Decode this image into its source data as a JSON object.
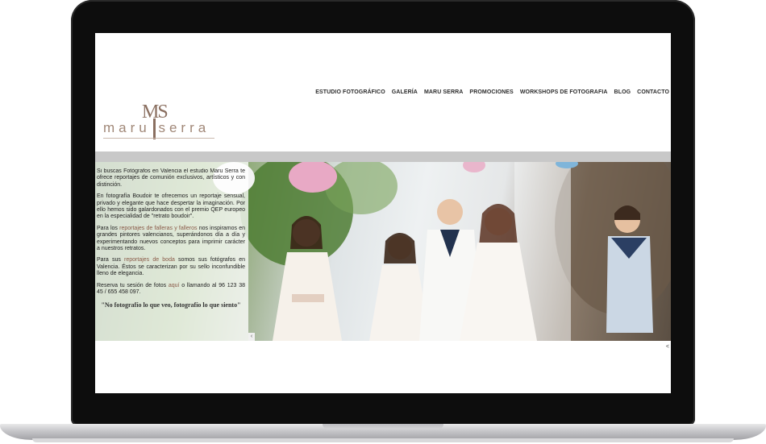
{
  "site": {
    "logo": {
      "mark": "MS",
      "word": "maru serra"
    },
    "nav": [
      "ESTUDIO FOTOGRÁFICO",
      "GALERÍA",
      "MARU SERRA",
      "PROMOCIONES",
      "WORKSHOPS DE FOTOGRAFIA",
      "BLOG",
      "CONTACTO"
    ]
  },
  "content": {
    "p1": "Si buscas Fotógrafos en Valencia el estudio Maru Serra te ofrece reportajes de comunión exclusivos, artísticos y con distinción.",
    "p2": "En fotografía Boudoir te ofrecemos un reportaje sensual, privado y elegante que hace despertar la imaginación. Por ello hemos sido galardonados con el premio QEP europeo en la especialidad de \"retrato boudoir\".",
    "p3_pre": "Para los",
    "p3_link": "reportajes de falleras y falleros",
    "p3_post": "nos inspiramos en grandes pintores valencianos, superándonos día a día y experimentando nuevos conceptos para imprimir carácter a nuestros retratos.",
    "p4_pre": "Para sus",
    "p4_link": "reportajes de boda",
    "p4_post": "somos sus fotógrafos en Valencia. Éstos se caracterizan por su sello inconfundible lleno de elegancia.",
    "p5_pre": "Reserva tu sesión de fotos",
    "p5_link": "aquí",
    "p5_post": "o llamando al 96 123 38 45 / 655 458 097.",
    "quote": "\"No fotografío lo que veo, fotografío lo que siento\""
  },
  "controls": {
    "prev": "‹",
    "share": "<"
  },
  "colors": {
    "brand": "#8a6f60",
    "band": "#c8c8c8",
    "frame": "#0d0d0d"
  }
}
